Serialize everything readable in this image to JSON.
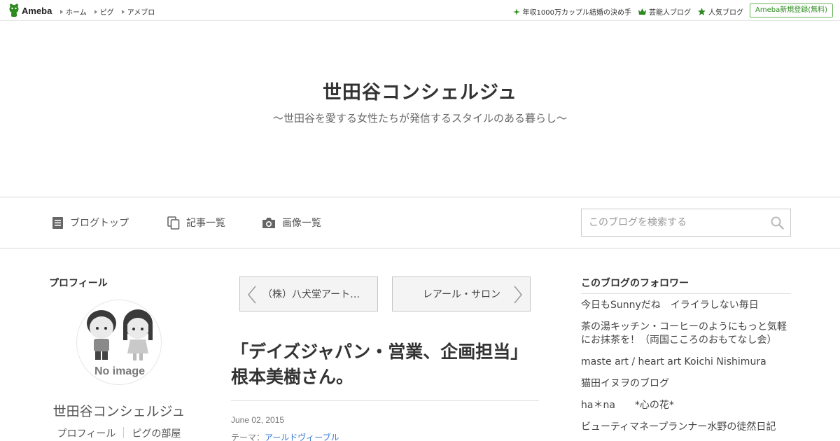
{
  "header": {
    "logo_text": "Ameba",
    "nav": [
      "ホーム",
      "ピグ",
      "アメブロ"
    ],
    "right_links": [
      {
        "label": "年収1000万カップル結婚の決め手",
        "icon": "sparkle-icon"
      },
      {
        "label": "芸能人ブログ",
        "icon": "crown-icon"
      },
      {
        "label": "人気ブログ",
        "icon": "star-icon"
      }
    ],
    "register_label": "Ameba新規登録(無料)"
  },
  "blog": {
    "title": "世田谷コンシェルジュ",
    "description": "～世田谷を愛する女性たちが発信するスタイルのある暮らし～"
  },
  "blog_nav": {
    "items": [
      {
        "label": "ブログトップ",
        "icon": "document-icon"
      },
      {
        "label": "記事一覧",
        "icon": "copy-icon"
      },
      {
        "label": "画像一覧",
        "icon": "camera-icon"
      }
    ],
    "search_placeholder": "このブログを検索する"
  },
  "profile": {
    "heading": "プロフィール",
    "avatar_text": "No image",
    "name": "世田谷コンシェルジュ",
    "links": [
      "プロフィール",
      "ピグの部屋"
    ]
  },
  "entry": {
    "prev_label": "（株）八犬堂アート…",
    "next_label": "レアール・サロン",
    "title": "「デイズジャパン・営業、企画担当」根本美樹さん。",
    "date": "June 02, 2015",
    "theme_label": "テーマ：",
    "theme_value": "アールドヴィーブル"
  },
  "followers": {
    "heading": "このブログのフォロワー",
    "items": [
      "今日もSunnyだね　イライラしない毎日",
      "茶の湯キッチン・コーヒーのようにもっと気軽にお抹茶を！（両国こころのおもてなし会）",
      "maste art / heart art Koichi Nishimura",
      "猫田イヌヲのブログ",
      "ha＊na　　*心の花*",
      "ビューティマネープランナー水野の徒然日記"
    ]
  },
  "colors": {
    "ameba_green": "#2d8a1f",
    "link_blue": "#3a7bd5",
    "border_gray": "#d8d8d8"
  }
}
